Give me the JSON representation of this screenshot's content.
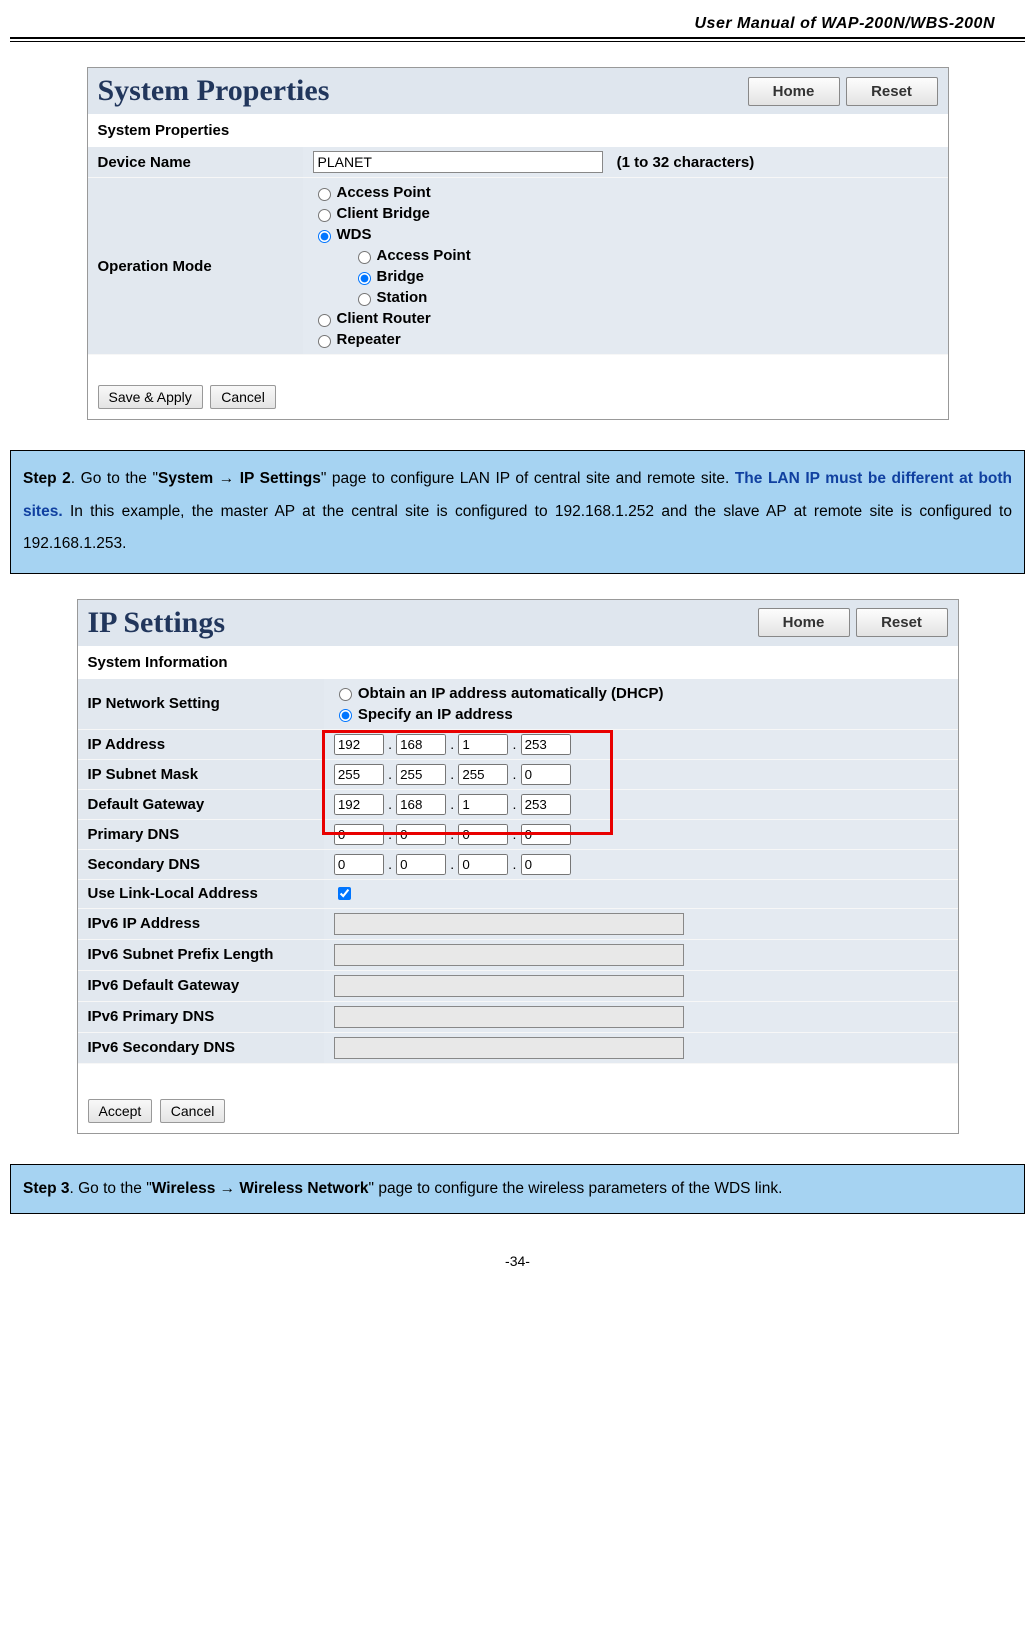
{
  "header": {
    "title": "User Manual of WAP-200N/WBS-200N"
  },
  "footer": {
    "page": "-34-"
  },
  "panel1": {
    "title": "System Properties",
    "btn_home": "Home",
    "btn_reset": "Reset",
    "section": "System Properties",
    "row_device": "Device Name",
    "device_value": "PLANET",
    "device_hint": "(1 to 32 characters)",
    "row_mode": "Operation Mode",
    "modes": {
      "ap": "Access Point",
      "cb": "Client Bridge",
      "wds": "WDS",
      "wds_ap": "Access Point",
      "wds_bridge": "Bridge",
      "wds_station": "Station",
      "cr": "Client Router",
      "rp": "Repeater"
    },
    "btn_save": "Save & Apply",
    "btn_cancel": "Cancel"
  },
  "step2": {
    "prefix": "Step 2",
    "t1": ". Go to the \"",
    "bold1": "System → IP Settings",
    "t2": "\" page to configure LAN IP of central site and remote site. ",
    "note": "The LAN IP must be different at both sites.",
    "t3": " In this example, the master AP at the central site is configured to 192.168.1.252 and the slave AP at remote site is configured to 192.168.1.253."
  },
  "panel2": {
    "title": "IP Settings",
    "btn_home": "Home",
    "btn_reset": "Reset",
    "section": "System Information",
    "rows": {
      "net": "IP Network Setting",
      "net_opt1": "Obtain an IP address automatically (DHCP)",
      "net_opt2": "Specify an IP address",
      "ip": "IP Address",
      "mask": "IP Subnet Mask",
      "gw": "Default Gateway",
      "pdns": "Primary DNS",
      "sdns": "Secondary DNS",
      "ll": "Use Link-Local Address",
      "v6ip": "IPv6 IP Address",
      "v6pl": "IPv6 Subnet Prefix Length",
      "v6gw": "IPv6 Default Gateway",
      "v6pd": "IPv6 Primary DNS",
      "v6sd": "IPv6 Secondary DNS"
    },
    "ip_addr": [
      "192",
      "168",
      "1",
      "253"
    ],
    "mask": [
      "255",
      "255",
      "255",
      "0"
    ],
    "gw": [
      "192",
      "168",
      "1",
      "253"
    ],
    "pdns": [
      "0",
      "0",
      "0",
      "0"
    ],
    "sdns": [
      "0",
      "0",
      "0",
      "0"
    ],
    "btn_accept": "Accept",
    "btn_cancel": "Cancel"
  },
  "step3": {
    "prefix": "Step 3",
    "t1": ". Go to the \"",
    "bold1": "Wireless → Wireless Network",
    "t2": "\" page to configure the wireless parameters of the WDS link."
  }
}
